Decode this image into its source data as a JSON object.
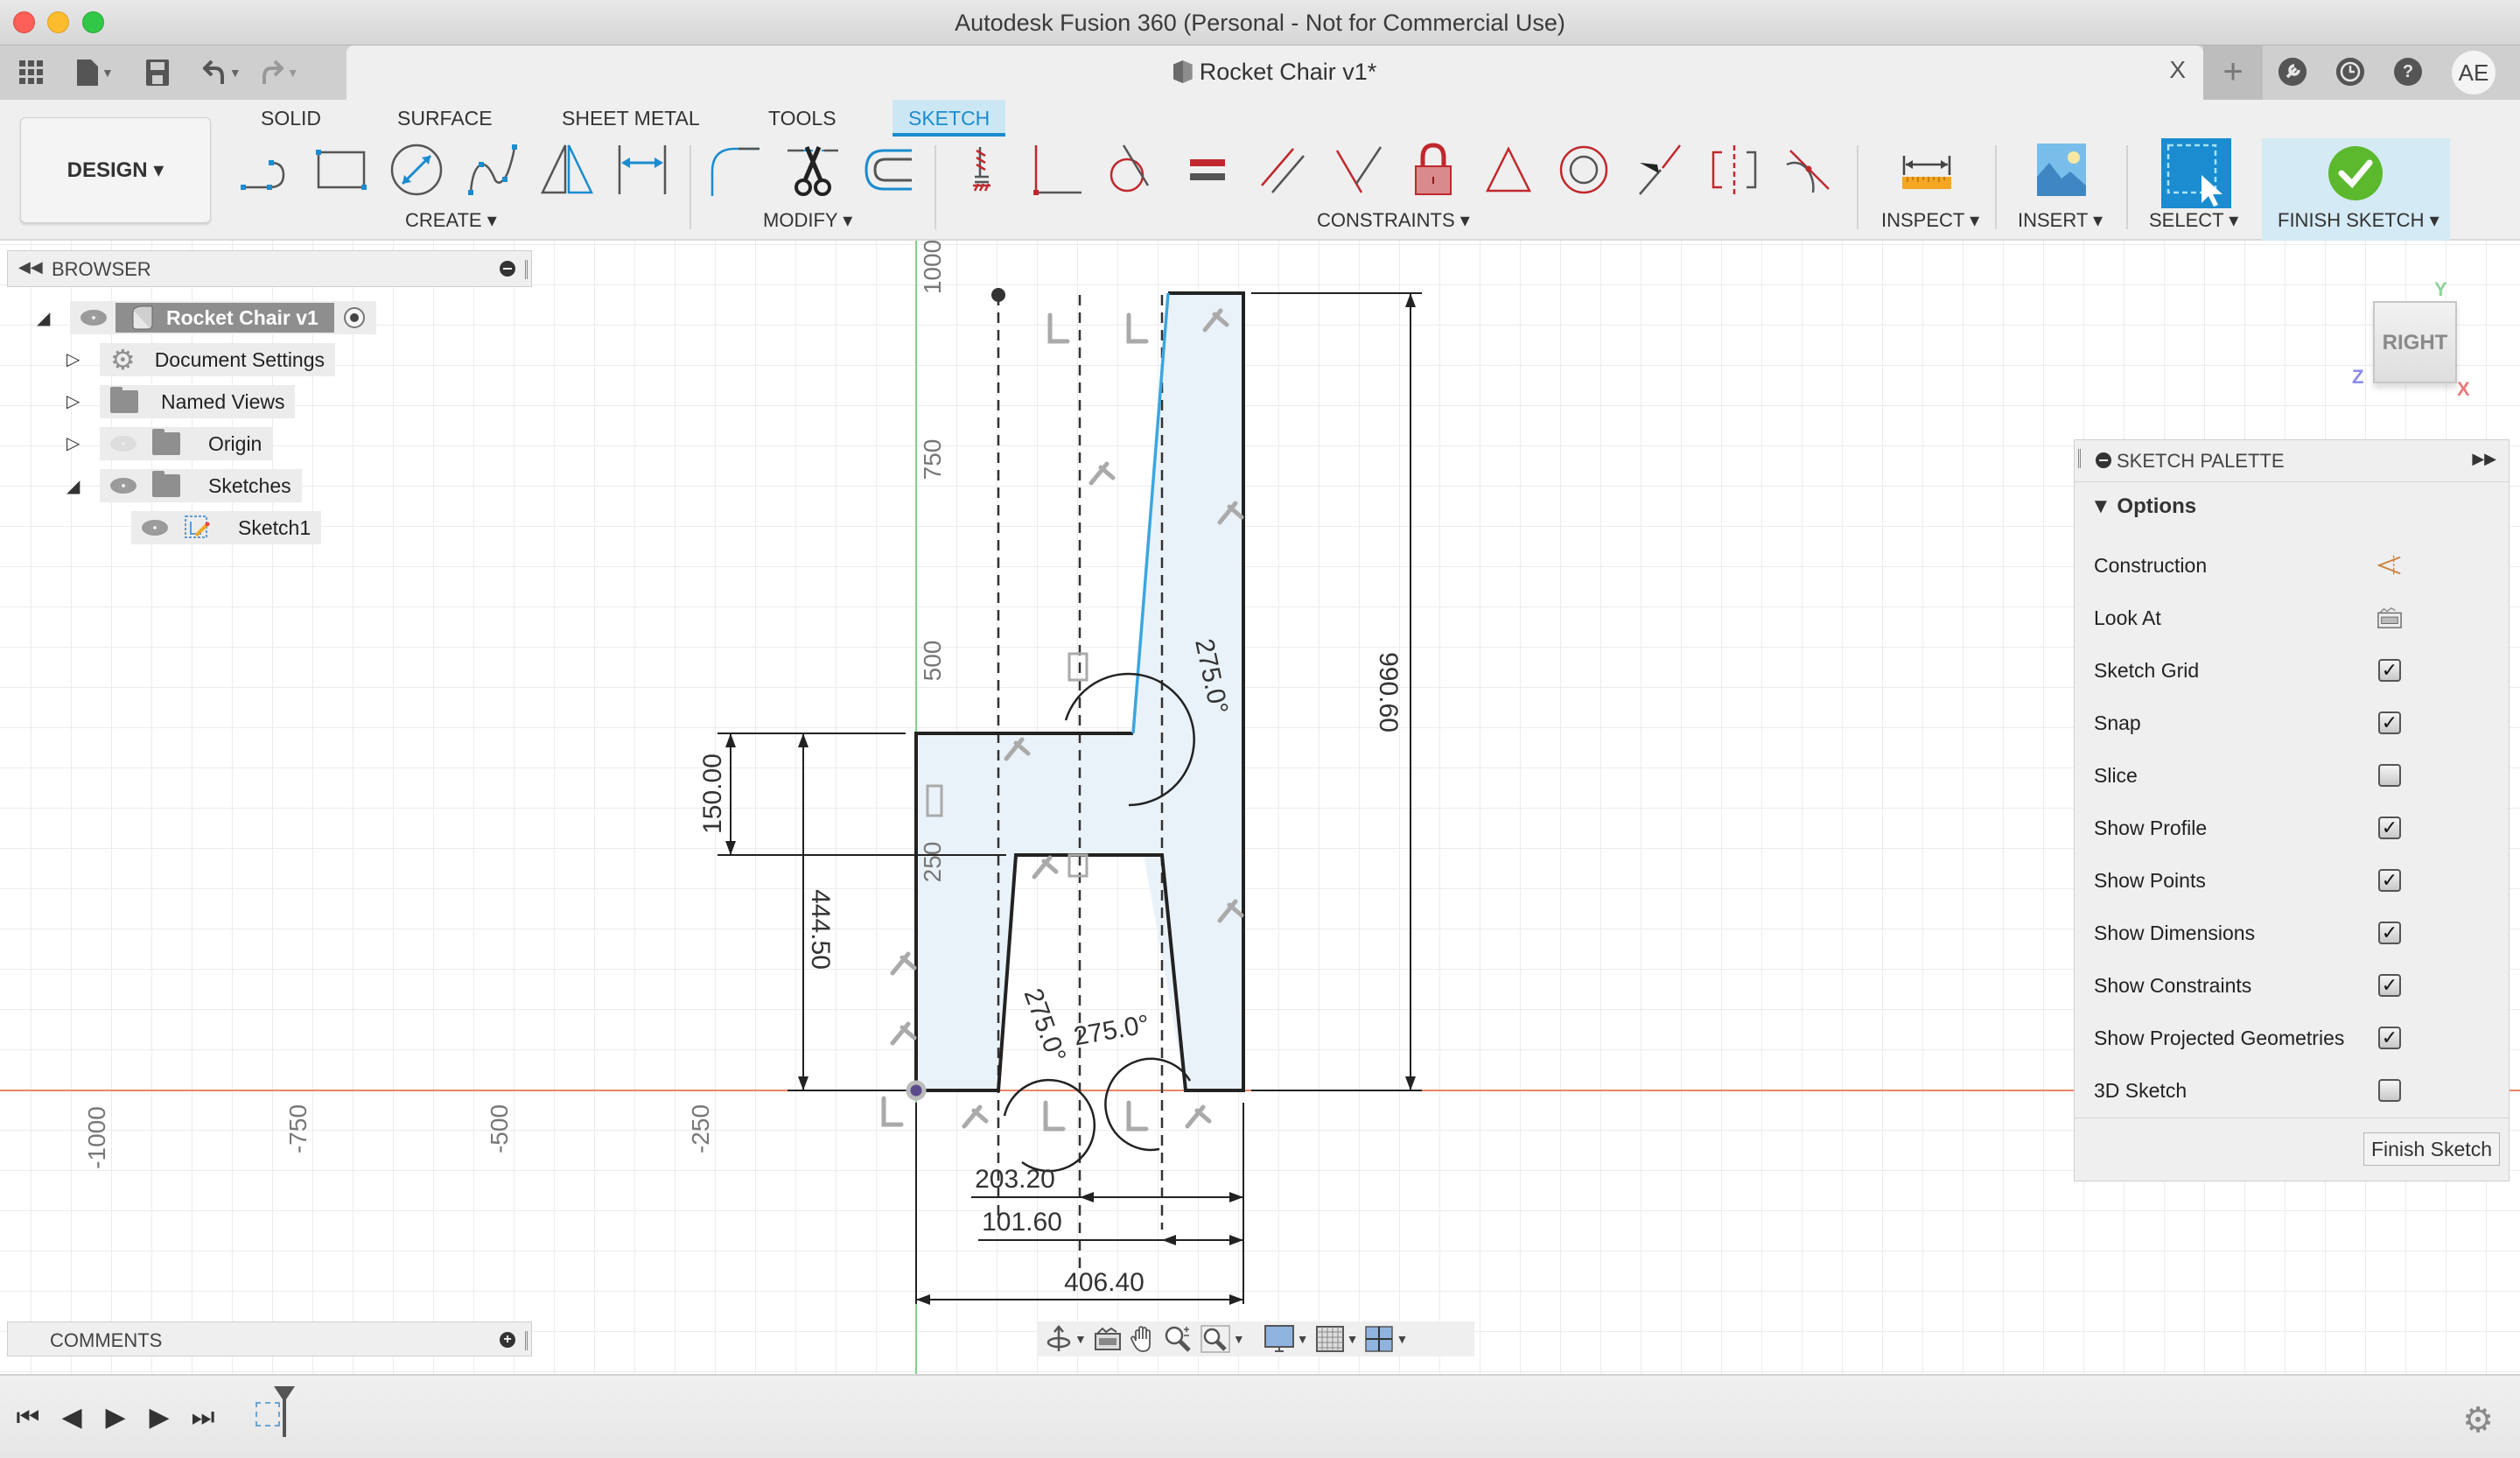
{
  "window": {
    "title": "Autodesk Fusion 360 (Personal - Not for Commercial Use)"
  },
  "quick_access": {
    "grid_icon": "app-grid-icon",
    "file_icon": "file-icon",
    "save_icon": "save-icon",
    "undo_icon": "undo-icon",
    "redo_icon": "redo-icon"
  },
  "document_tab": {
    "title": "Rocket Chair v1*",
    "close": "X",
    "new_tab": "+"
  },
  "header_right": {
    "extensions_icon": "extensions-icon",
    "job_status_icon": "job-status-icon",
    "help_icon": "?",
    "avatar": "AE"
  },
  "toolbar": {
    "workspace": "DESIGN ▾",
    "tabs": [
      {
        "label": "SOLID",
        "active": false
      },
      {
        "label": "SURFACE",
        "active": false
      },
      {
        "label": "SHEET METAL",
        "active": false
      },
      {
        "label": "TOOLS",
        "active": false
      },
      {
        "label": "SKETCH",
        "active": true
      }
    ],
    "groups": {
      "create": "CREATE ▾",
      "modify": "MODIFY ▾",
      "constraints": "CONSTRAINTS ▾",
      "inspect": "INSPECT ▾",
      "insert": "INSERT ▾",
      "select": "SELECT ▾",
      "finish": "FINISH SKETCH ▾"
    },
    "create_tools": [
      "line",
      "rectangle",
      "circle",
      "spline",
      "mirror",
      "sketch-dimension"
    ],
    "modify_tools": [
      "fillet",
      "trim",
      "offset"
    ],
    "constraint_tools": [
      "fix",
      "coincident",
      "tangent",
      "equal",
      "parallel",
      "perpendicular",
      "lock",
      "midpoint",
      "concentric",
      "collinear",
      "symmetry",
      "curvature"
    ]
  },
  "browser": {
    "title": "BROWSER",
    "items": [
      {
        "label": "Rocket Chair v1",
        "level": 0,
        "expanded": true,
        "visible": true,
        "type": "component"
      },
      {
        "label": "Document Settings",
        "level": 1,
        "expanded": false,
        "type": "settings"
      },
      {
        "label": "Named Views",
        "level": 1,
        "expanded": false,
        "type": "folder"
      },
      {
        "label": "Origin",
        "level": 1,
        "expanded": false,
        "visible": false,
        "type": "folder"
      },
      {
        "label": "Sketches",
        "level": 1,
        "expanded": true,
        "visible": true,
        "type": "folder"
      },
      {
        "label": "Sketch1",
        "level": 2,
        "visible": true,
        "type": "sketch"
      }
    ]
  },
  "comments": {
    "title": "COMMENTS"
  },
  "viewcube": {
    "face": "RIGHT",
    "axes": {
      "y": "Y",
      "z": "Z",
      "x": "X"
    }
  },
  "sketch_palette": {
    "title": "SKETCH PALETTE",
    "section": "Options",
    "options": [
      {
        "label": "Construction",
        "type": "icon",
        "icon": "construction-icon"
      },
      {
        "label": "Look At",
        "type": "icon",
        "icon": "look-at-icon"
      },
      {
        "label": "Sketch Grid",
        "type": "checkbox",
        "checked": true
      },
      {
        "label": "Snap",
        "type": "checkbox",
        "checked": true
      },
      {
        "label": "Slice",
        "type": "checkbox",
        "checked": false
      },
      {
        "label": "Show Profile",
        "type": "checkbox",
        "checked": true
      },
      {
        "label": "Show Points",
        "type": "checkbox",
        "checked": true
      },
      {
        "label": "Show Dimensions",
        "type": "checkbox",
        "checked": true
      },
      {
        "label": "Show Constraints",
        "type": "checkbox",
        "checked": true
      },
      {
        "label": "Show Projected Geometries",
        "type": "checkbox",
        "checked": true
      },
      {
        "label": "3D Sketch",
        "type": "checkbox",
        "checked": false
      }
    ],
    "finish_button": "Finish Sketch"
  },
  "sketch": {
    "axis_labels_vertical": [
      "1000",
      "750",
      "500",
      "250"
    ],
    "axis_labels_horizontal": [
      "-1000",
      "-750",
      "-500",
      "-250"
    ],
    "dimensions": {
      "total_height": "990.60",
      "seat_thickness": "150.00",
      "seat_height": "444.50",
      "angle_back": "275.0°",
      "angle_leg_left": "275.0°",
      "angle_leg_right": "275.0°",
      "half_width": "203.20",
      "quarter_width": "101.60",
      "total_width": "406.40"
    },
    "colors": {
      "profile_fill": "#eaf2f9",
      "x_axis": "#e8866a",
      "y_axis": "#7fd38a",
      "selected_line": "#3ba6e0"
    }
  },
  "navbar": {
    "tools": [
      "orbit-icon",
      "look-at-icon",
      "pan-icon",
      "zoom-icon",
      "fit-icon",
      "display-settings-icon",
      "grid-settings-icon",
      "viewports-icon"
    ]
  },
  "timeline": {
    "controls": [
      "first",
      "previous",
      "play",
      "next",
      "last"
    ],
    "items": [
      "Sketch1"
    ]
  }
}
